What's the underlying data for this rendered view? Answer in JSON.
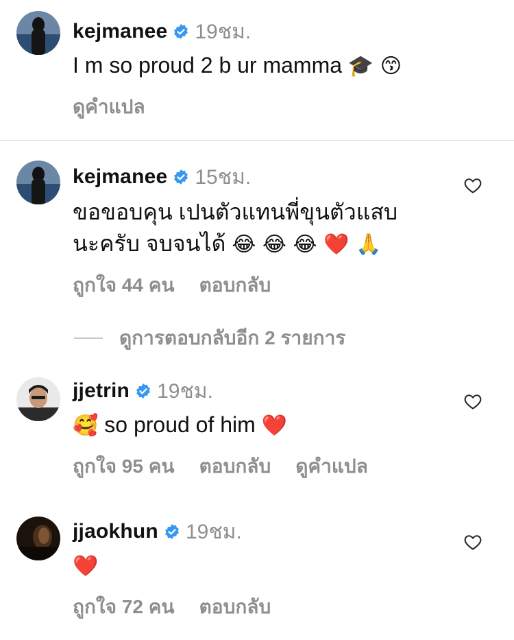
{
  "comments": [
    {
      "username": "kejmanee",
      "time": "19ชม.",
      "text": "I m so proud 2 b ur mamma",
      "emoji": "🎓 😙",
      "actions": {
        "translate": "ดูคำแปล"
      }
    },
    {
      "username": "kejmanee",
      "time": "15ชม.",
      "text_line1": "ขอขอบคุน เปนตัวแทนพี่ขุนตัวแสบ",
      "text_line2": "นะครับ  จบจนได้",
      "emoji": "😂 😂 😂  ❤️ 🙏",
      "actions": {
        "likes": "ถูกใจ 44 คน",
        "reply": "ตอบกลับ"
      }
    },
    {
      "username": "jjetrin",
      "time": "19ชม.",
      "emoji_lead": "🥰",
      "text": "so proud of him",
      "emoji": "❤️",
      "actions": {
        "likes": "ถูกใจ 95 คน",
        "reply": "ตอบกลับ",
        "translate": "ดูคำแปล"
      }
    },
    {
      "username": "jjaokhun",
      "time": "19ชม.",
      "emoji": "❤️",
      "actions": {
        "likes": "ถูกใจ 72 คน",
        "reply": "ตอบกลับ"
      }
    }
  ],
  "view_more_replies": "ดูการตอบกลับอีก 2 รายการ",
  "colors": {
    "verified": "#3897f0",
    "muted": "#8e8e8e",
    "divider": "#dbdbdb"
  },
  "icons": {
    "verified": "verified-badge-icon",
    "like": "heart-outline-icon"
  }
}
